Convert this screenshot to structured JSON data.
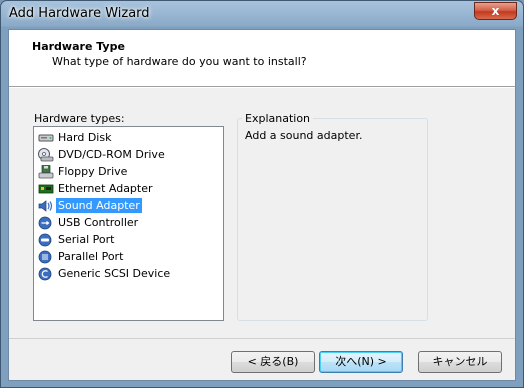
{
  "window": {
    "title": "Add Hardware Wizard",
    "close_glyph": "x"
  },
  "header": {
    "title": "Hardware Type",
    "subtitle": "What type of hardware do you want to install?"
  },
  "hardware_list": {
    "label": "Hardware types:",
    "items": [
      {
        "label": "Hard Disk",
        "icon": "hard-disk-icon"
      },
      {
        "label": "DVD/CD-ROM Drive",
        "icon": "dvd-drive-icon"
      },
      {
        "label": "Floppy Drive",
        "icon": "floppy-drive-icon"
      },
      {
        "label": "Ethernet Adapter",
        "icon": "ethernet-adapter-icon"
      },
      {
        "label": "Sound Adapter",
        "icon": "sound-adapter-icon",
        "selected": true
      },
      {
        "label": "USB Controller",
        "icon": "usb-controller-icon"
      },
      {
        "label": "Serial Port",
        "icon": "serial-port-icon"
      },
      {
        "label": "Parallel Port",
        "icon": "parallel-port-icon"
      },
      {
        "label": "Generic SCSI Device",
        "icon": "scsi-device-icon"
      }
    ]
  },
  "explanation": {
    "label": "Explanation",
    "text": "Add a sound adapter."
  },
  "buttons": {
    "back": "< 戻る(B)",
    "next": "次へ(N) >",
    "cancel": "キャンセル"
  },
  "colors": {
    "selection": "#3399ff",
    "titlebar": "#8aaac8"
  }
}
